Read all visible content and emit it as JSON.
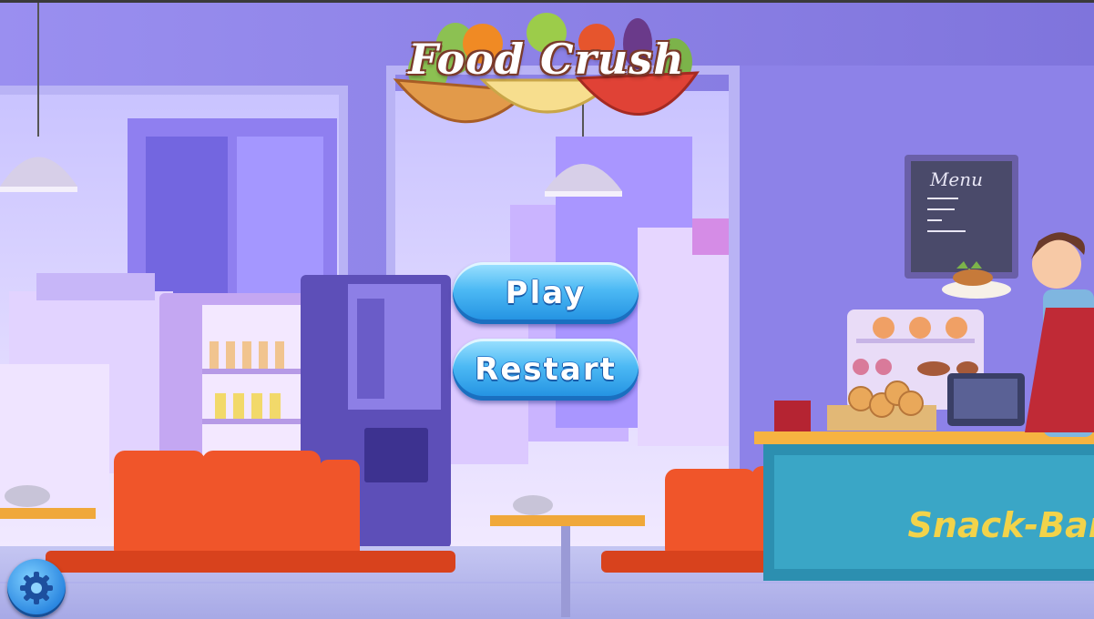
{
  "game": {
    "title": "Food Crush",
    "menu": {
      "play_label": "Play",
      "restart_label": "Restart"
    },
    "settings_icon": "gear-icon",
    "scene_signs": {
      "menu_board": "Menu",
      "counter_sign": "Snack-Bar"
    }
  },
  "colors": {
    "button_blue": "#3aa6f0",
    "wall_purple": "#8a7fe0",
    "chair_orange": "#f0552a",
    "counter_teal": "#2c8fb0"
  }
}
